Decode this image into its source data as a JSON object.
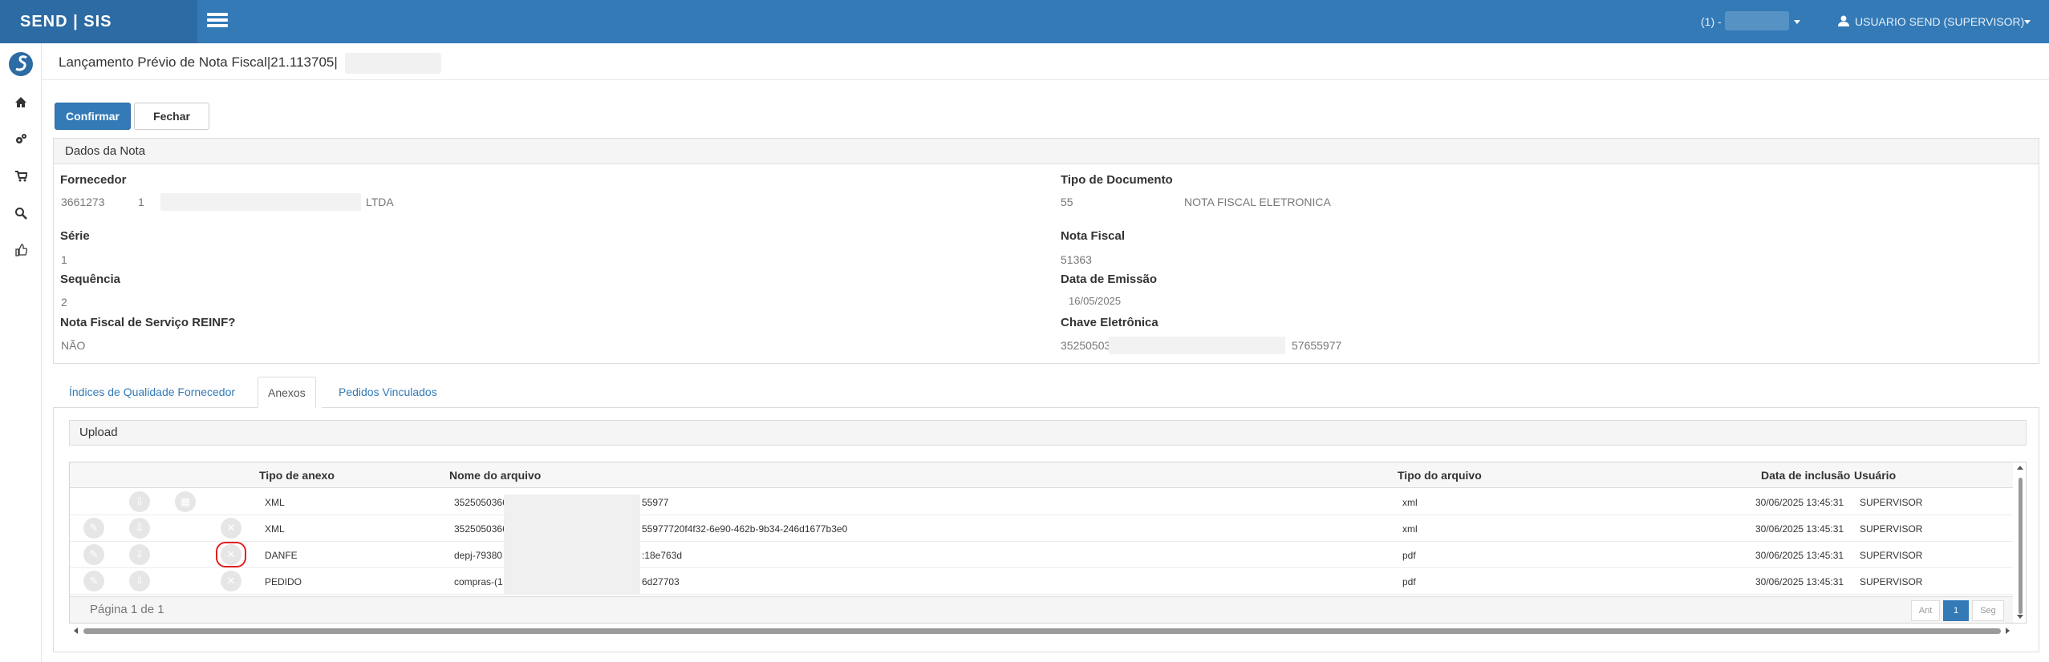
{
  "app": {
    "brand": "SEND | SIS",
    "company": "(1) -",
    "user": "USUARIO SEND (SUPERVISOR)"
  },
  "colors": {
    "primary": "#337ab7",
    "brand_dark": "#2c6ba3",
    "highlight": "#e02020"
  },
  "page": {
    "title": "Lançamento Prévio de Nota Fiscal|21.113705|"
  },
  "toolbar": {
    "confirm_label": "Confirmar",
    "close_label": "Fechar"
  },
  "sidebar": {
    "items": [
      "logo-icon",
      "home-icon",
      "settings-icon",
      "cart-icon",
      "search-icon",
      "thumbs-up-icon"
    ]
  },
  "nota": {
    "panel_title": "Dados da Nota",
    "fornecedor_label": "Fornecedor",
    "fornecedor_code": "3661273",
    "fornecedor_loja": "1",
    "fornecedor_name_suffix": "LTDA",
    "tipo_doc_label": "Tipo de Documento",
    "tipo_doc_code": "55",
    "tipo_doc_desc": "NOTA FISCAL ELETRONICA",
    "serie_label": "Série",
    "serie_value": "1",
    "nota_fiscal_label": "Nota Fiscal",
    "nota_fiscal_value": "51363",
    "sequencia_label": "Sequência",
    "sequencia_value": "2",
    "data_emissao_label": "Data de Emissão",
    "data_emissao_value": "16/05/2025",
    "reinf_label": "Nota Fiscal de Serviço REINF?",
    "reinf_value": "NÃO",
    "chave_label": "Chave Eletrônica",
    "chave_prefix": "35250503",
    "chave_suffix": "57655977"
  },
  "tabs": [
    {
      "label": "Índices de Qualidade Fornecedor"
    },
    {
      "label": "Anexos"
    },
    {
      "label": "Pedidos Vinculados"
    }
  ],
  "anexos": {
    "upload_label": "Upload",
    "columns": {
      "tipo_anexo": "Tipo de anexo",
      "nome_arquivo": "Nome do arquivo",
      "tipo_arquivo": "Tipo do arquivo",
      "data_inclusao": "Data de inclusão",
      "usuario": "Usuário"
    },
    "rows": [
      {
        "tipo_anexo": "XML",
        "nome_prefix": "3525050366",
        "nome_suffix": "55977",
        "tipo_arquivo": "xml",
        "data": "30/06/2025 13:45:31",
        "usuario": "SUPERVISOR"
      },
      {
        "tipo_anexo": "XML",
        "nome_prefix": "3525050366",
        "nome_suffix": "55977720f4f32-6e90-462b-9b34-246d1677b3e0",
        "tipo_arquivo": "xml",
        "data": "30/06/2025 13:45:31",
        "usuario": "SUPERVISOR"
      },
      {
        "tipo_anexo": "DANFE",
        "nome_prefix": "depj-79380",
        "nome_suffix": ":18e763d",
        "tipo_arquivo": "pdf",
        "data": "30/06/2025 13:45:31",
        "usuario": "SUPERVISOR"
      },
      {
        "tipo_anexo": "PEDIDO",
        "nome_prefix": "compras-(1",
        "nome_suffix": "6d27703",
        "tipo_arquivo": "pdf",
        "data": "30/06/2025 13:45:31",
        "usuario": "SUPERVISOR"
      }
    ],
    "pager": {
      "text": "Página 1 de 1",
      "prev": "Ant",
      "current": "1",
      "next": "Seg"
    }
  }
}
